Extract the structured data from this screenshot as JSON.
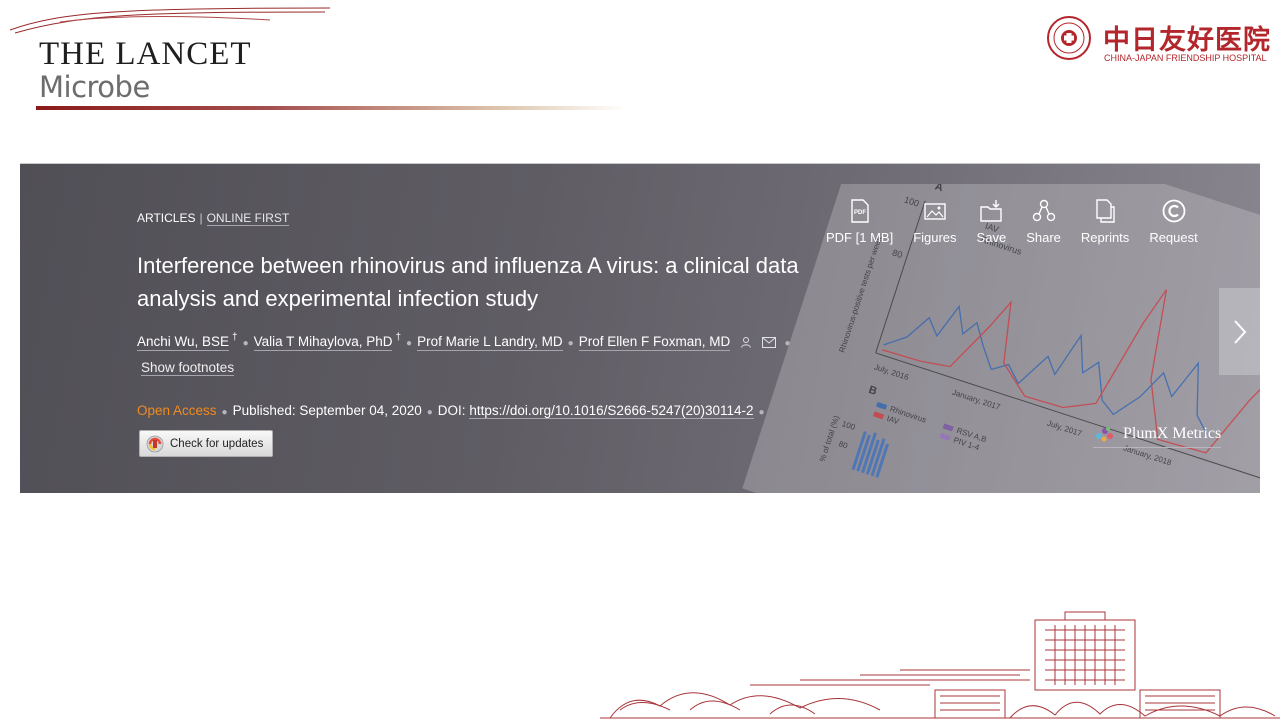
{
  "logo": {
    "title": "THE LANCET",
    "subtitle": "Microbe"
  },
  "hospital": {
    "name_cn": "中日友好医院",
    "name_en": "CHINA-JAPAN FRIENDSHIP HOSPITAL"
  },
  "article": {
    "breadcrumb": [
      "ARTICLES",
      "ONLINE FIRST"
    ],
    "title": "Interference between rhinovirus and influenza A virus: a clinical data analysis and experimental infection study",
    "authors": [
      {
        "name": "Anchi Wu, BSE",
        "mark": "†"
      },
      {
        "name": "Valia T Mihaylova, PhD",
        "mark": "†"
      },
      {
        "name": "Prof Marie L Landry, MD",
        "mark": ""
      },
      {
        "name": "Prof Ellen F Foxman, MD",
        "mark": ""
      }
    ],
    "show_footnotes": "Show footnotes",
    "open_access": "Open Access",
    "published_label": "Published:",
    "published_date": "September 04, 2020",
    "doi_label": "DOI:",
    "doi": "https://doi.org/10.1016/S2666-5247(20)30114-2",
    "check_updates": "Check for updates",
    "plumx": "PlumX Metrics",
    "accent_color": "#f08b1e"
  },
  "tools": [
    {
      "label": "PDF [1 MB]",
      "icon": "pdf-icon"
    },
    {
      "label": "Figures",
      "icon": "image-icon"
    },
    {
      "label": "Save",
      "icon": "save-icon"
    },
    {
      "label": "Share",
      "icon": "share-icon"
    },
    {
      "label": "Reprints",
      "icon": "reprints-icon"
    },
    {
      "label": "Request",
      "icon": "copyright-icon"
    }
  ],
  "background_figure": {
    "panel_a": "A",
    "panel_b": "B",
    "y_tick_100": "100",
    "y_tick_80": "80",
    "y_axis_label": "Rhinovirus-positive tests per week",
    "legend": [
      "IAV",
      "Rhinovirus"
    ],
    "x_ticks": [
      "July, 2016",
      "January, 2017",
      "July, 2017",
      "January, 2018"
    ],
    "panel_b_legend": [
      "Rhinovirus",
      "IAV",
      "RSV A,B",
      "PIV 1-4"
    ],
    "panel_b_ylabel": "% of total (%)",
    "panel_b_tick": "100",
    "panel_b_tick2": "80"
  }
}
